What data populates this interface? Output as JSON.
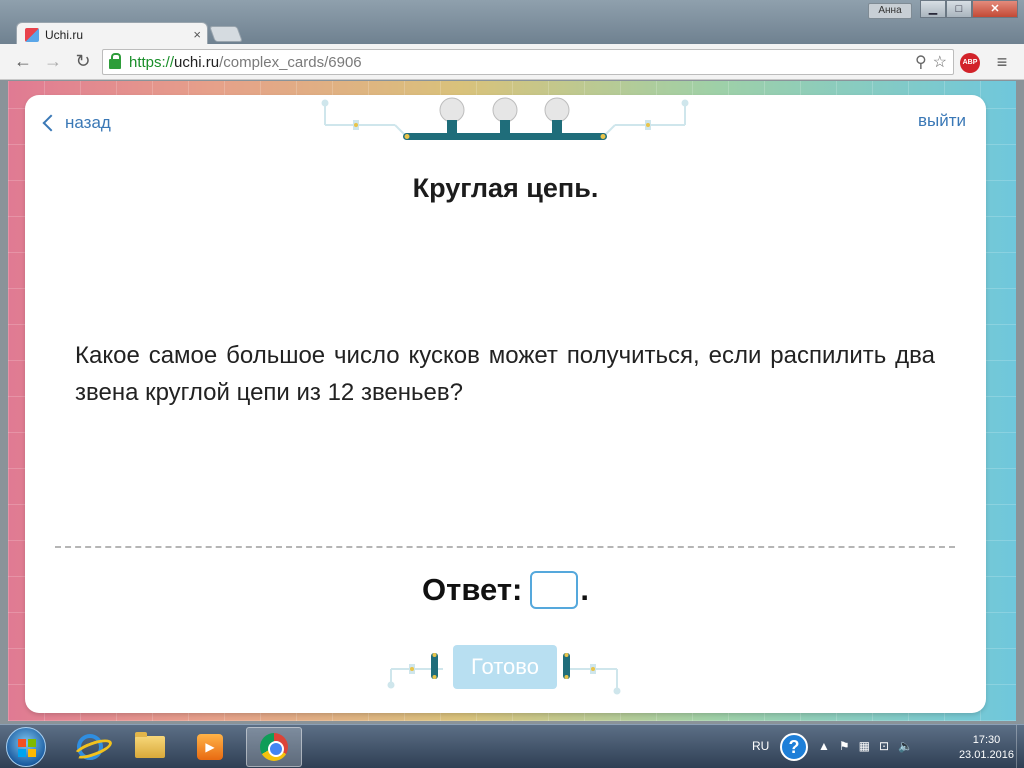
{
  "browser": {
    "tab_title": "Uchi.ru",
    "tab_close": "×",
    "profile_name": "Анна",
    "window_buttons": {
      "minimize": "▁",
      "maximize": "□",
      "close": "✕"
    },
    "nav": {
      "back": "←",
      "forward": "→",
      "reload": "↻"
    },
    "url": {
      "scheme": "https://",
      "host": "uchi.ru",
      "path": "/complex_cards/6906"
    },
    "omnibox_icons": {
      "zoom": "⚲",
      "star": "☆"
    },
    "abp_label": "ABP",
    "menu": "≡"
  },
  "card": {
    "back_label": "назад",
    "exit_label": "выйти",
    "title": "Круглая цепь.",
    "question": "Какое самое большое число кусков может получиться, если распилить два звена круглой цепи из 12 звеньев?",
    "answer_label": "Ответ:",
    "answer_value": "",
    "answer_suffix": ".",
    "ready_label": "Готово"
  },
  "colors": {
    "link": "#3a78b6",
    "answer_border": "#55a8dc",
    "ready_button": "#b8dff1",
    "circuit_teal": "#1f6d7a"
  },
  "taskbar": {
    "language": "RU",
    "help": "?",
    "tray_icons": [
      "▲",
      "⚑",
      "▦",
      "⊡",
      "🔈"
    ],
    "time": "17:30",
    "date": "23.01.2016",
    "pinned": [
      "ie-icon",
      "folder-icon",
      "media-player-icon",
      "chrome-icon"
    ]
  }
}
